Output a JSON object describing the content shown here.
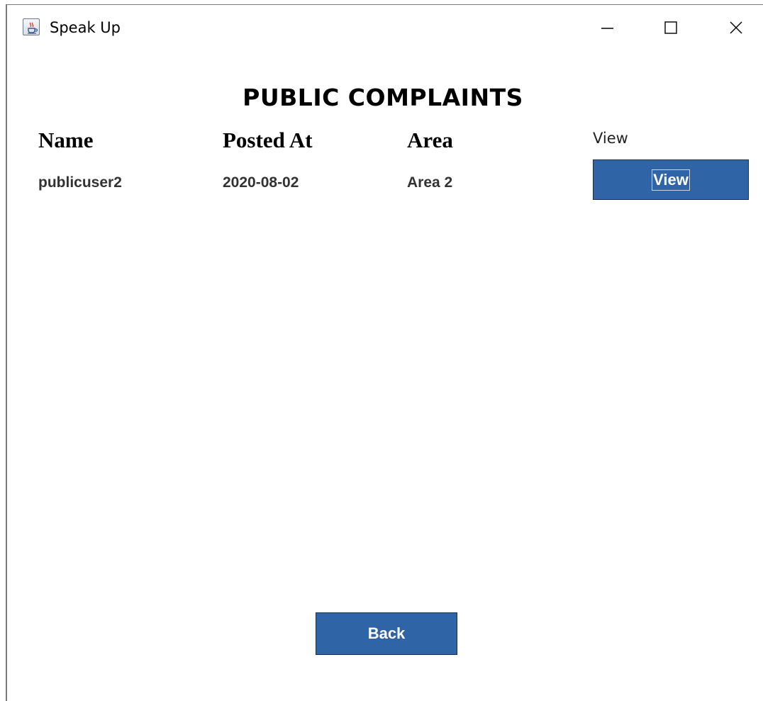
{
  "window": {
    "title": "Speak Up",
    "icon": "java-cup-icon"
  },
  "heading": "PUBLIC COMPLAINTS",
  "table": {
    "columns": [
      "Name",
      "Posted At",
      "Area",
      "View"
    ],
    "rows": [
      {
        "name": "publicuser2",
        "posted_at": "2020-08-02",
        "area": "Area 2",
        "action_label": "View"
      }
    ]
  },
  "buttons": {
    "back_label": "Back"
  },
  "colors": {
    "button_bg": "#2f65a6",
    "button_text": "#ffffff"
  }
}
